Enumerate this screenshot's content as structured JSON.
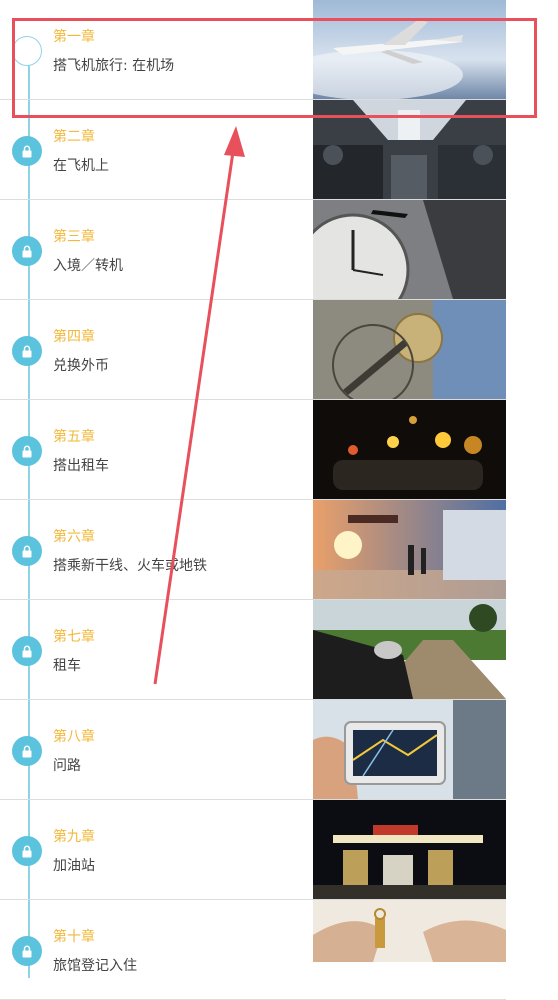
{
  "chapters": [
    {
      "chapter": "第一章",
      "title": "搭飞机旅行: 在机场",
      "locked": false,
      "image": "airplane-sky-photo"
    },
    {
      "chapter": "第二章",
      "title": "在飞机上",
      "locked": true,
      "image": "airplane-cabin-photo"
    },
    {
      "chapter": "第三章",
      "title": "入境／转机",
      "locked": true,
      "image": "clock-airplane-photo"
    },
    {
      "chapter": "第四章",
      "title": "兑换外币",
      "locked": true,
      "image": "currency-exchange-photo"
    },
    {
      "chapter": "第五章",
      "title": "搭出租车",
      "locked": true,
      "image": "taxi-night-photo"
    },
    {
      "chapter": "第六章",
      "title": "搭乘新干线、火车或地铁",
      "locked": true,
      "image": "train-platform-photo"
    },
    {
      "chapter": "第七章",
      "title": "租车",
      "locked": true,
      "image": "car-driving-photo"
    },
    {
      "chapter": "第八章",
      "title": "问路",
      "locked": true,
      "image": "gps-navigator-photo"
    },
    {
      "chapter": "第九章",
      "title": "加油站",
      "locked": true,
      "image": "gas-station-photo"
    },
    {
      "chapter": "第十章",
      "title": "旅馆登记入住",
      "locked": true,
      "image": "hotel-key-photo"
    }
  ],
  "icons": {
    "locked": "lock-icon"
  },
  "colors": {
    "accent": "#5cc3de",
    "chapter_label": "#f2b83a",
    "annotation": "#e8505b"
  }
}
